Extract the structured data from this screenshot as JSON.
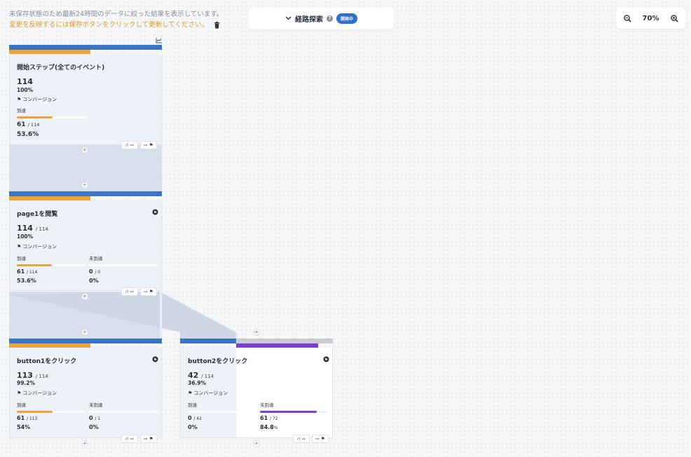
{
  "notice": {
    "line1": "未保存状態のため最新24時間のデータに絞った結果を表示しています。",
    "line2": "変更を反映するには保存ボタンをクリックして更新してください。"
  },
  "header": {
    "title": "経路探索",
    "help": "?",
    "badge": "開発中"
  },
  "zoom": {
    "level": "70%"
  },
  "colors": {
    "blue": "#3a75c4",
    "orange": "#f0a33a",
    "purple": "#7b3fd6",
    "grey": "#c9ccd1"
  },
  "cards": [
    {
      "title": "開始ステップ(全てのイベント)",
      "count": "114",
      "count_total": "",
      "percent": "100%",
      "conversion_label": "コンバージョン",
      "reached_label": "到達",
      "reached_value": "61",
      "reached_total": "/ 114",
      "reached_pct": "53.6%",
      "reached_fill": 0.536,
      "actions": [
        "⛙ ⇨",
        "⇨ ⚑"
      ]
    },
    {
      "title": "page1を閲覧",
      "count": "114",
      "count_total": "/ 114",
      "percent": "100%",
      "conversion_label": "コンバージョン",
      "reached_label": "到達",
      "reached_value": "61",
      "reached_total": "/ 114",
      "reached_pct": "53.6%",
      "reached_fill": 0.536,
      "unreached_label": "未到達",
      "unreached_value": "0",
      "unreached_total": "/ 0",
      "unreached_pct": "0%",
      "actions": [
        "⛙ ⇨",
        "⇨ ⚑"
      ]
    },
    {
      "title": "button1をクリック",
      "count": "113",
      "count_total": "/ 114",
      "percent": "99.2%",
      "conversion_label": "コンバージョン",
      "reached_label": "到達",
      "reached_value": "61",
      "reached_total": "/ 113",
      "reached_pct": "54%",
      "reached_fill": 0.54,
      "unreached_label": "未到達",
      "unreached_value": "0",
      "unreached_total": "/ 1",
      "unreached_pct": "0%",
      "actions": [
        "⛙ ⇨",
        "⇨ ⚑"
      ]
    },
    {
      "title": "button2をクリック",
      "count": "42",
      "count_total": "/ 114",
      "percent": "36.9%",
      "conversion_label": "コンバージョン",
      "reached_label": "到達",
      "reached_value": "0",
      "reached_total": "/ 42",
      "reached_pct": "0%",
      "reached_fill": 0,
      "unreached_label": "未到達",
      "unreached_value": "61",
      "unreached_total": "/ 72",
      "unreached_pct": "84.8",
      "unreached_pct_unit": "%",
      "unreached_fill": 0.848,
      "actions": [
        "⛙ ⇨",
        "⇨ ⚑"
      ]
    }
  ]
}
